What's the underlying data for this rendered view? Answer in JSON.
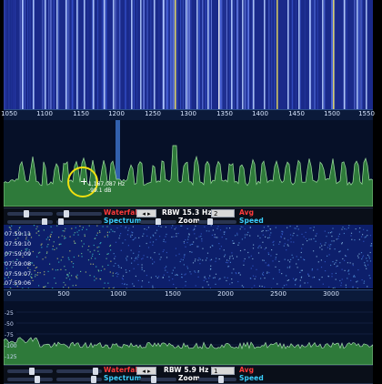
{
  "top_axis": {
    "ticks": [
      "1050",
      "1100",
      "1150",
      "1200",
      "1250",
      "1300",
      "1350",
      "1400",
      "1450",
      "1500",
      "1550"
    ]
  },
  "cursor": {
    "frequency": "1,167,087 Hz",
    "level": "-99.1 dB"
  },
  "toolbar1": {
    "waterfall_label": "Waterfall",
    "rbw_label": "RBW 15.3 Hz",
    "avg_value": "2",
    "avg_label": "Avg",
    "spectrum_label": "Spectrum",
    "zoom_label": "Zoom",
    "speed_label": "Speed"
  },
  "waterfall2": {
    "times": [
      "07:59:11",
      "07:59:10",
      "07:59:09",
      "07:59:08",
      "07:59:07",
      "07:59:06"
    ]
  },
  "bottom_axis": {
    "ticks": [
      "0",
      "500",
      "1000",
      "1500",
      "2000",
      "2500",
      "3000"
    ]
  },
  "spectrum2": {
    "ylabels": [
      "-25",
      "-50",
      "-75",
      "-100",
      "-125"
    ]
  },
  "toolbar2": {
    "waterfall_label": "Waterfall",
    "rbw_label": "RBW 5.9 Hz",
    "avg_value": "1",
    "avg_label": "Avg",
    "spectrum_label": "Spectrum",
    "zoom_label": "Zoom",
    "speed_label": "Speed"
  },
  "colors": {
    "waterfall_label": "#ff3b3b",
    "spectrum_label": "#3bd0ff",
    "speed_label": "#3bd0ff",
    "avg_label": "#ff3b3b"
  }
}
